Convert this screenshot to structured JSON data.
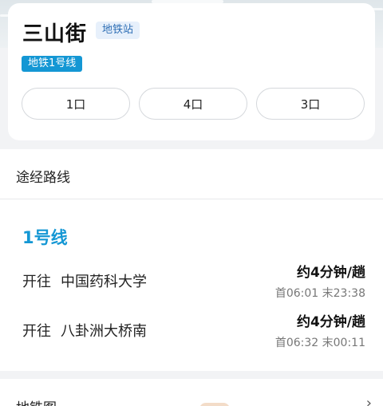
{
  "station": {
    "name": "三山街",
    "type_badge": "地铁站",
    "line_badge": "地铁1号线",
    "exits": [
      "1口",
      "4口",
      "3口"
    ]
  },
  "routes": {
    "section_title": "途经路线",
    "line_name": "1号线",
    "directions": [
      {
        "prefix": "开往",
        "destination": "中国药科大学",
        "interval": "约4分钟/趟",
        "times": "首06:01 末23:38"
      },
      {
        "prefix": "开往",
        "destination": "八卦洲大桥南",
        "interval": "约4分钟/趟",
        "times": "首06:32 末00:11"
      }
    ]
  },
  "map": {
    "title": "地铁图",
    "chevron": "›"
  },
  "colors": {
    "line_blue": "#1497d4",
    "badge_bg": "#e7f0fb",
    "badge_text": "#2f6fb5"
  }
}
